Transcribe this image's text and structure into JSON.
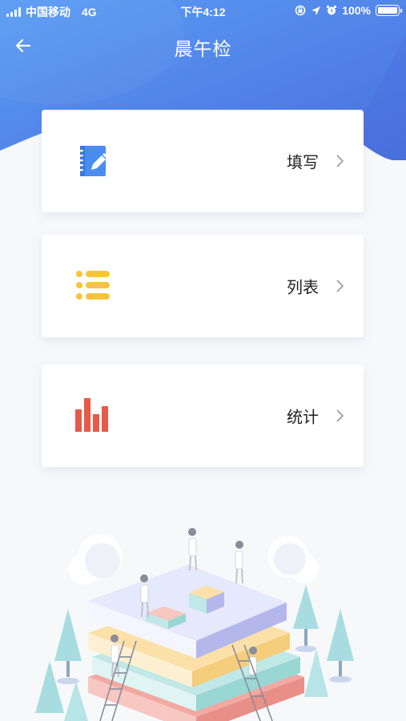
{
  "status_bar": {
    "carrier": "中国移动",
    "network": "4G",
    "time": "下午4:12",
    "battery_text": "100%",
    "battery_level": 1.0
  },
  "navbar": {
    "title": "晨午检",
    "back_icon": "arrow-left-icon"
  },
  "menu": [
    {
      "label": "填写",
      "icon": "notebook-edit-icon",
      "icon_color": "#4a8cf0"
    },
    {
      "label": "列表",
      "icon": "list-icon",
      "icon_color": "#f7c43e"
    },
    {
      "label": "统计",
      "icon": "bar-chart-icon",
      "icon_color": "#e85a47"
    }
  ],
  "colors": {
    "header_gradient_start": "#4f8ff1",
    "header_gradient_end": "#4f76e0",
    "page_background": "#f7f8fa",
    "chevron": "#999999"
  }
}
